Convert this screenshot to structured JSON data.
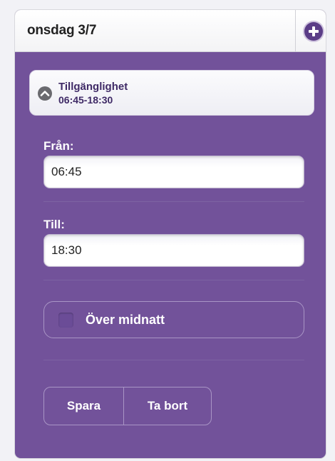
{
  "header": {
    "title": "onsdag 3/7",
    "add_icon": "plus-circle-icon"
  },
  "availability": {
    "title": "Tillgänglighet",
    "time_range": "06:45-18:30",
    "collapse_icon": "chevron-up-icon"
  },
  "form": {
    "from_label": "Från:",
    "from_value": "06:45",
    "to_label": "Till:",
    "to_value": "18:30",
    "over_midnight_label": "Över midnatt",
    "over_midnight_checked": false
  },
  "actions": {
    "save_label": "Spara",
    "delete_label": "Ta bort"
  },
  "colors": {
    "panel_background": "#72529a",
    "accent": "#5b3d87",
    "page_background": "#f2f2f6"
  }
}
